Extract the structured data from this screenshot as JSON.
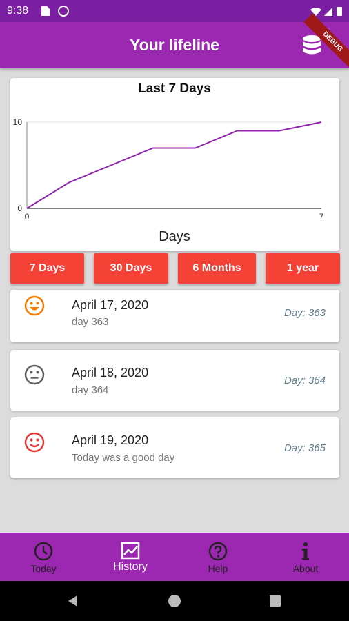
{
  "status": {
    "time": "9:38"
  },
  "app_bar": {
    "title": "Your lifeline",
    "debug_label": "DEBUG"
  },
  "chart_data": {
    "type": "line",
    "title": "Last 7 Days",
    "xlabel": "Days",
    "ylabel": "",
    "x": [
      0,
      1,
      2,
      3,
      4,
      5,
      6,
      7
    ],
    "values": [
      0,
      3,
      5,
      7,
      7,
      9,
      9,
      10
    ],
    "xlim": [
      0,
      7
    ],
    "ylim": [
      0,
      10
    ],
    "xticks": [
      "0",
      "7"
    ],
    "yticks": [
      "0",
      "10"
    ],
    "color": "#8e24aa"
  },
  "ranges": {
    "d7": "7 Days",
    "d30": "30 Days",
    "m6": "6 Months",
    "y1": "1 year"
  },
  "entries": [
    {
      "date": "April 17, 2020",
      "note": "day 363",
      "day": "Day: 363",
      "mood": "happy",
      "color": "#f57c00"
    },
    {
      "date": "April 18, 2020",
      "note": "day 364",
      "day": "Day: 364",
      "mood": "neutral",
      "color": "#616161"
    },
    {
      "date": "April 19, 2020",
      "note": "Today was a good day",
      "day": "Day: 365",
      "mood": "smile",
      "color": "#e53935"
    }
  ],
  "nav": {
    "today": "Today",
    "history": "History",
    "help": "Help",
    "about": "About"
  }
}
